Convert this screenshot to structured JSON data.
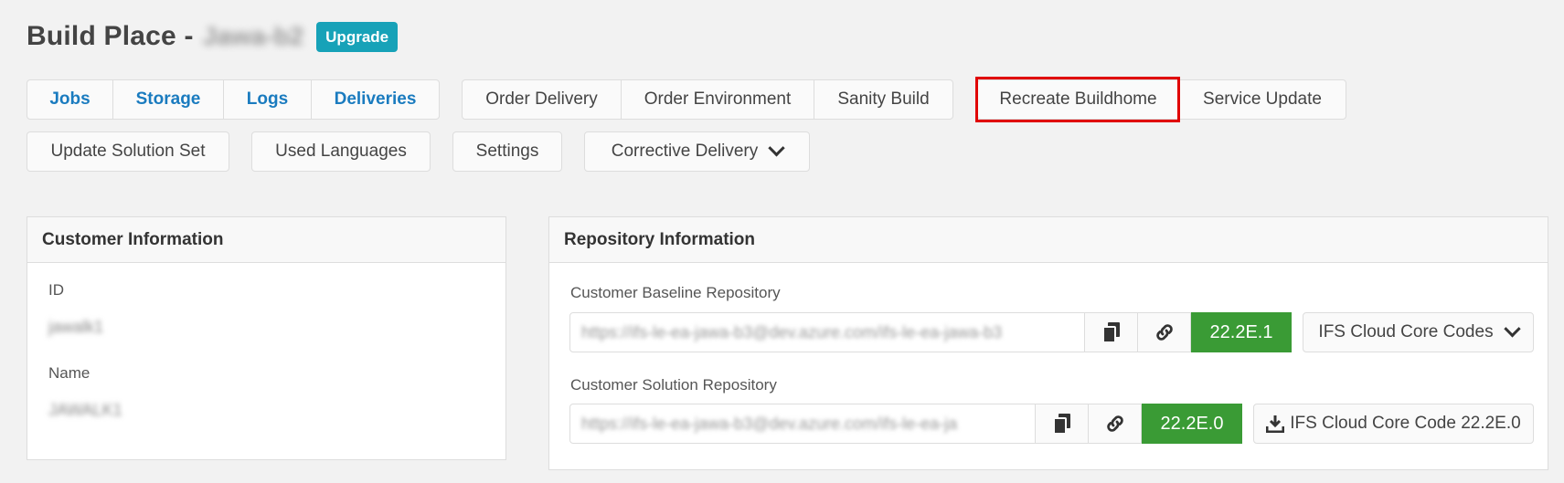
{
  "header": {
    "title": "Build Place -",
    "project_name": "Jawa-b2",
    "upgrade_label": "Upgrade"
  },
  "nav_tabs": [
    "Jobs",
    "Storage",
    "Logs",
    "Deliveries"
  ],
  "actions": {
    "order_delivery": "Order Delivery",
    "order_environment": "Order Environment",
    "sanity_build": "Sanity Build",
    "recreate_buildhome": "Recreate Buildhome",
    "service_update": "Service Update",
    "update_solution_set": "Update Solution Set",
    "used_languages": "Used Languages",
    "settings": "Settings",
    "corrective_delivery": "Corrective Delivery"
  },
  "customer": {
    "heading": "Customer Information",
    "id_label": "ID",
    "id_value": "jawalk1",
    "name_label": "Name",
    "name_value": "JAWALK1"
  },
  "repository": {
    "heading": "Repository Information",
    "baseline_label": "Customer Baseline Repository",
    "baseline_url": "https://ifs-le-ea-jawa-b3@dev.azure.com/ifs-le-ea-jawa-b3",
    "baseline_version": "22.2E.1",
    "baseline_dropdown": "IFS Cloud Core Codes",
    "solution_label": "Customer Solution Repository",
    "solution_url": "https://ifs-le-ea-jawa-b3@dev.azure.com/ifs-le-ea-ja",
    "solution_version": "22.2E.0",
    "solution_download": "IFS Cloud Core Code 22.2E.0"
  },
  "icons": [
    "copy-icon",
    "link-icon",
    "chevron-down-icon",
    "download-icon"
  ],
  "colors": {
    "accent_link": "#1a7bbf",
    "upgrade": "#17a2b8",
    "version_green": "#3a9b35",
    "highlight": "#e00000"
  }
}
